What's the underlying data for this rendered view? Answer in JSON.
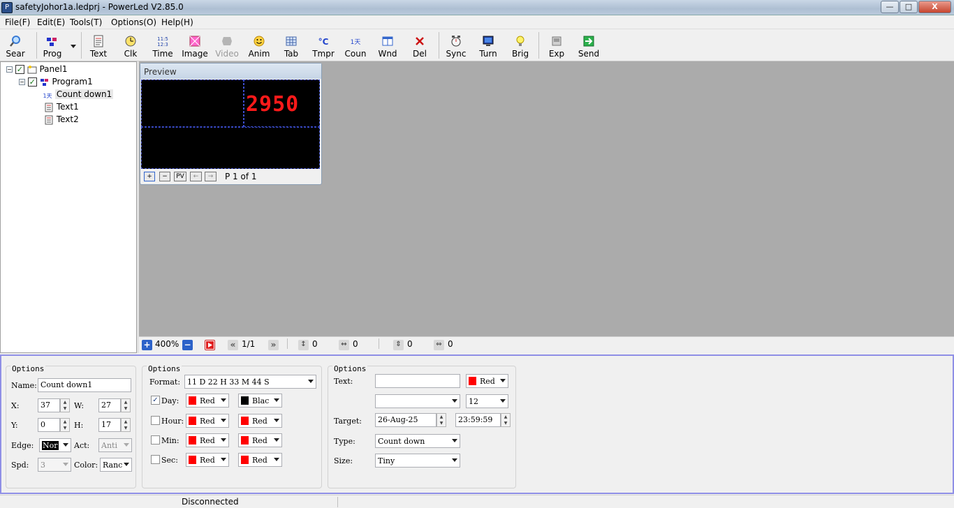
{
  "window": {
    "title": "safetyJohor1a.ledprj - PowerLed V2.85.0",
    "min_label": "—",
    "max_label": "□",
    "close_label": "X"
  },
  "menu": [
    "File(F)",
    "Edit(E)",
    "Tools(T)",
    "Options(O)",
    "Help(H)"
  ],
  "toolbar": {
    "buttons": [
      {
        "label": "Sear",
        "icon": "magnifier-icon"
      },
      {
        "label": "Prog",
        "icon": "program-icon"
      },
      {
        "label": "Text",
        "icon": "text-icon"
      },
      {
        "label": "Clk",
        "icon": "clock-icon"
      },
      {
        "label": "Time",
        "icon": "time-icon"
      },
      {
        "label": "Image",
        "icon": "image-icon"
      },
      {
        "label": "Video",
        "icon": "video-icon",
        "disabled": true
      },
      {
        "label": "Anim",
        "icon": "smiley-icon"
      },
      {
        "label": "Tab",
        "icon": "table-icon"
      },
      {
        "label": "Tmpr",
        "icon": "temperature-icon"
      },
      {
        "label": "Coun",
        "icon": "countdown-icon"
      },
      {
        "label": "Wnd",
        "icon": "window-icon"
      },
      {
        "label": "Del",
        "icon": "delete-icon"
      },
      {
        "label": "Sync",
        "icon": "sync-icon"
      },
      {
        "label": "Turn",
        "icon": "turn-icon"
      },
      {
        "label": "Brig",
        "icon": "brightness-icon"
      },
      {
        "label": "Exp",
        "icon": "export-icon"
      },
      {
        "label": "Send",
        "icon": "send-icon"
      }
    ]
  },
  "tree": {
    "panel": "Panel1",
    "program": "Program1",
    "items": [
      "Count down1",
      "Text1",
      "Text2"
    ]
  },
  "preview": {
    "title": "Preview",
    "led_value": "2950",
    "page_status": "P 1 of 1",
    "btn_plus": "+",
    "btn_minus": "−",
    "btn_pv": "PV",
    "btn_prev": "←",
    "btn_next": "→"
  },
  "canvas_status": {
    "zoom": "400%",
    "page": "1/1",
    "v_offset": "0",
    "h_offset": "0",
    "v_size": "0",
    "h_size": "0"
  },
  "options_basic": {
    "title": "Options",
    "name_label": "Name:",
    "name_value": "Count down1",
    "x_label": "X:",
    "x_value": "37",
    "w_label": "W:",
    "w_value": "27",
    "y_label": "Y:",
    "y_value": "0",
    "h_label": "H:",
    "h_value": "17",
    "edge_label": "Edge:",
    "edge_value": "Nor",
    "act_label": "Act:",
    "act_value": "Anti",
    "spd_label": "Spd:",
    "spd_value": "3",
    "color_label": "Color:",
    "color_value": "Ranc"
  },
  "options_format": {
    "title": "Options",
    "format_label": "Format:",
    "format_value": "11 D 22 H 33 M 44 S",
    "rows": [
      {
        "label": "Day:",
        "checked": true,
        "color1": "Red",
        "color1_hex": "#ff0000",
        "color2": "Blac",
        "color2_hex": "#000000"
      },
      {
        "label": "Hour:",
        "checked": false,
        "color1": "Red",
        "color1_hex": "#ff0000",
        "color2": "Red",
        "color2_hex": "#ff0000"
      },
      {
        "label": "Min:",
        "checked": false,
        "color1": "Red",
        "color1_hex": "#ff0000",
        "color2": "Red",
        "color2_hex": "#ff0000"
      },
      {
        "label": "Sec:",
        "checked": false,
        "color1": "Red",
        "color1_hex": "#ff0000",
        "color2": "Red",
        "color2_hex": "#ff0000"
      }
    ]
  },
  "options_target": {
    "title": "Options",
    "text_label": "Text:",
    "text_value": "",
    "text_color": "Red",
    "text_color_hex": "#ff0000",
    "font_value": "",
    "font_size": "12",
    "target_label": "Target:",
    "target_date": "26-Aug-25",
    "target_time": "23:59:59",
    "type_label": "Type:",
    "type_value": "Count down",
    "size_label": "Size:",
    "size_value": "Tiny"
  },
  "statusbar": {
    "connection": "Disconnected"
  }
}
